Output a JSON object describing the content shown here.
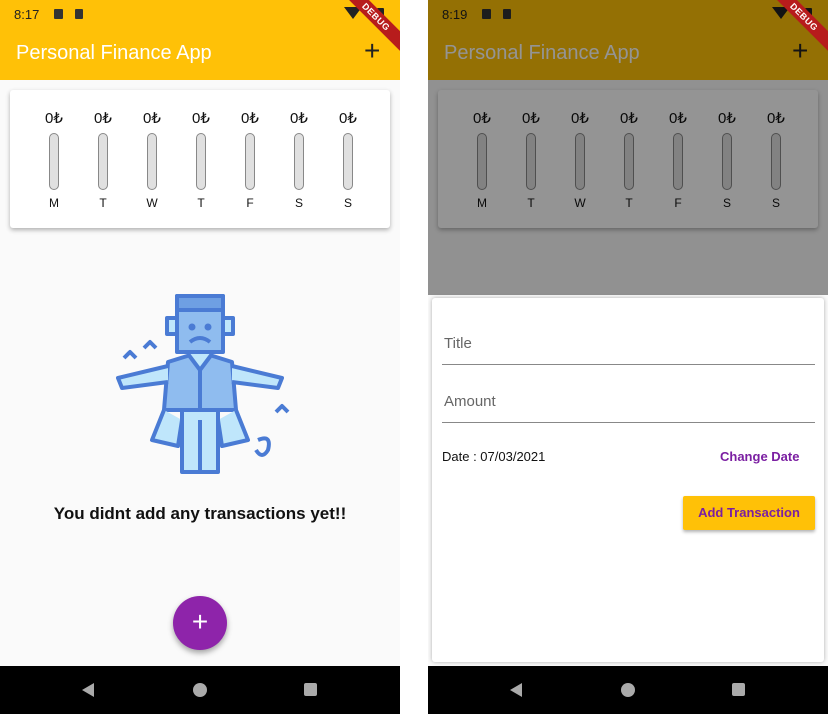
{
  "left": {
    "status_time": "8:17",
    "app_title": "Personal Finance App",
    "debug_label": "DEBUG",
    "add_symbol": "+",
    "chart": [
      {
        "amount": "0₺",
        "day": "M"
      },
      {
        "amount": "0₺",
        "day": "T"
      },
      {
        "amount": "0₺",
        "day": "W"
      },
      {
        "amount": "0₺",
        "day": "T"
      },
      {
        "amount": "0₺",
        "day": "F"
      },
      {
        "amount": "0₺",
        "day": "S"
      },
      {
        "amount": "0₺",
        "day": "S"
      }
    ],
    "spending_fractions": [
      0,
      0,
      0,
      0,
      0,
      0,
      0
    ],
    "empty_message": "You didnt add any transactions yet!!",
    "fab_symbol": "+"
  },
  "right": {
    "status_time": "8:19",
    "app_title": "Personal Finance App",
    "debug_label": "DEBUG",
    "add_symbol": "+",
    "chart": [
      {
        "amount": "0₺",
        "day": "M"
      },
      {
        "amount": "0₺",
        "day": "T"
      },
      {
        "amount": "0₺",
        "day": "W"
      },
      {
        "amount": "0₺",
        "day": "T"
      },
      {
        "amount": "0₺",
        "day": "F"
      },
      {
        "amount": "0₺",
        "day": "S"
      },
      {
        "amount": "0₺",
        "day": "S"
      }
    ],
    "form": {
      "title_placeholder": "Title",
      "amount_placeholder": "Amount",
      "date_text": "Date : 07/03/2021",
      "change_date_label": "Change Date",
      "submit_label": "Add Transaction"
    }
  },
  "colors": {
    "primary": "#ffc107",
    "accent": "#8e24aa",
    "accent_text": "#7b1fa2"
  }
}
